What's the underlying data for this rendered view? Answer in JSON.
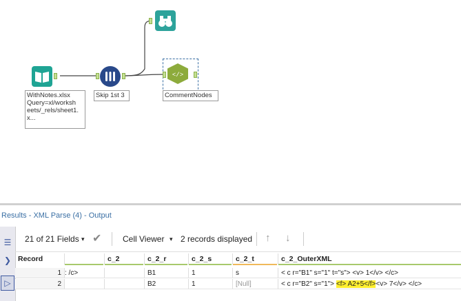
{
  "workflow": {
    "input_label": "WithNotes.xlsx Query=xl/worksh eets/_rels/sheet1.x...",
    "input_lines": [
      "WithNotes.xlsx",
      "Query=xl/worksh",
      "eets/_rels/sheet1.",
      "x..."
    ],
    "skip_label": "Skip 1st 3",
    "xml_label": "CommentNodes"
  },
  "results": {
    "title": "Results - XML Parse (4) - Output",
    "fields_label": "21 of 21 Fields",
    "cell_viewer_label": "Cell Viewer",
    "records_label": "2 records displayed",
    "columns": [
      "Record",
      "",
      "c_2",
      "c_2_r",
      "c_2_s",
      "c_2_t",
      "c_2_OuterXML"
    ],
    "rows": [
      {
        "record": "1",
        "partial": ": /c>",
        "c_2": "",
        "c_2_r": "B1",
        "c_2_s": "1",
        "c_2_t": "s",
        "xml_pre": "< c r=\"B1\" s=\"1\" t=\"s\"> <v> 1</v> </c>",
        "xml_hl": "",
        "xml_post": ""
      },
      {
        "record": "2",
        "partial": "",
        "c_2": "",
        "c_2_r": "B2",
        "c_2_s": "1",
        "c_2_t": "[Null]",
        "xml_pre": "< c r=\"B2\" s=\"1\">",
        "xml_hl": "<f> A2+5</f>",
        "xml_post": "<v> 7</v> </c>"
      }
    ]
  },
  "colors": {
    "accent": "#3a6fa4",
    "highlight": "#ffef2e",
    "input_tool": "#1fa494",
    "join_tool": "#29498a",
    "parse_tool": "#8dab3c"
  }
}
